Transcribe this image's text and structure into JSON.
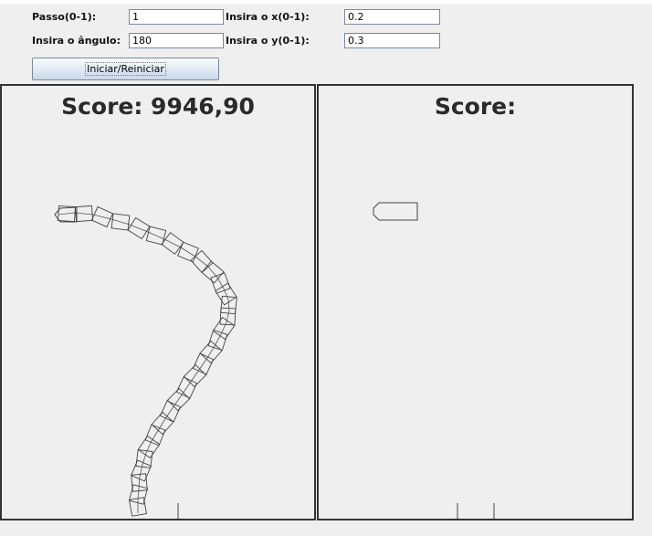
{
  "controls": {
    "passo": {
      "label": "Passo(0-1):",
      "value": "1"
    },
    "angulo": {
      "label": "Insira o ângulo:",
      "value": "180"
    },
    "x": {
      "label": "Insira o x(0-1):",
      "value": "0.2"
    },
    "y": {
      "label": "Insira o y(0-1):",
      "value": "0.3"
    },
    "start_button": "Iniciar/Reiniciar"
  },
  "panels": [
    {
      "score_text": "Score: 9946,90"
    },
    {
      "score_text": "Score:"
    }
  ],
  "colors": {
    "background": "#efefef",
    "border": "#333333",
    "snake_stroke": "#444444"
  }
}
